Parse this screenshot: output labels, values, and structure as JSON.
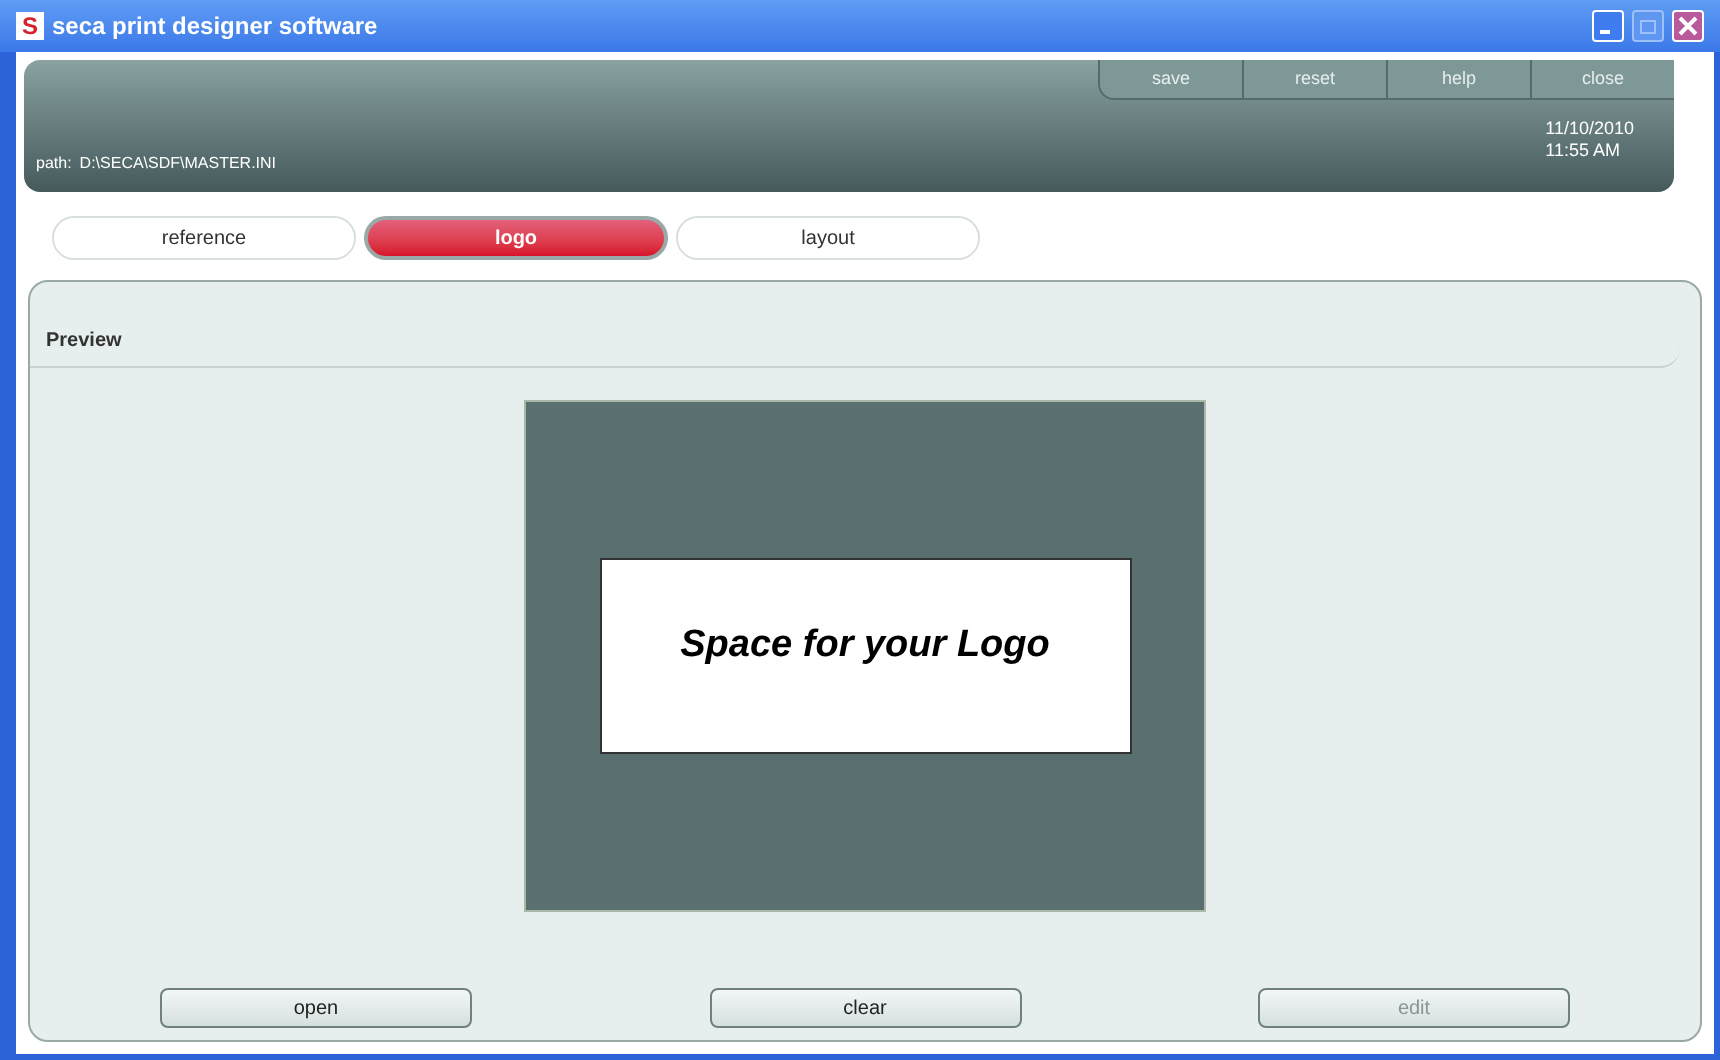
{
  "window": {
    "title": "seca print designer software",
    "app_letter": "S"
  },
  "header": {
    "path_label": "path:",
    "path": "D:\\SECA\\SDF\\MASTER.INI",
    "date": "11/10/2010",
    "time": "11:55 AM",
    "actions": [
      {
        "label": "save"
      },
      {
        "label": "reset"
      },
      {
        "label": "help"
      },
      {
        "label": "close"
      }
    ]
  },
  "tabs": [
    {
      "label": "reference",
      "selected": false
    },
    {
      "label": "logo",
      "selected": true
    },
    {
      "label": "layout",
      "selected": false
    }
  ],
  "preview": {
    "title": "Preview",
    "logo_text": "Space for your Logo"
  },
  "buttons": [
    {
      "label": "open",
      "disabled": false
    },
    {
      "label": "clear",
      "disabled": false
    },
    {
      "label": "edit",
      "disabled": true
    }
  ]
}
